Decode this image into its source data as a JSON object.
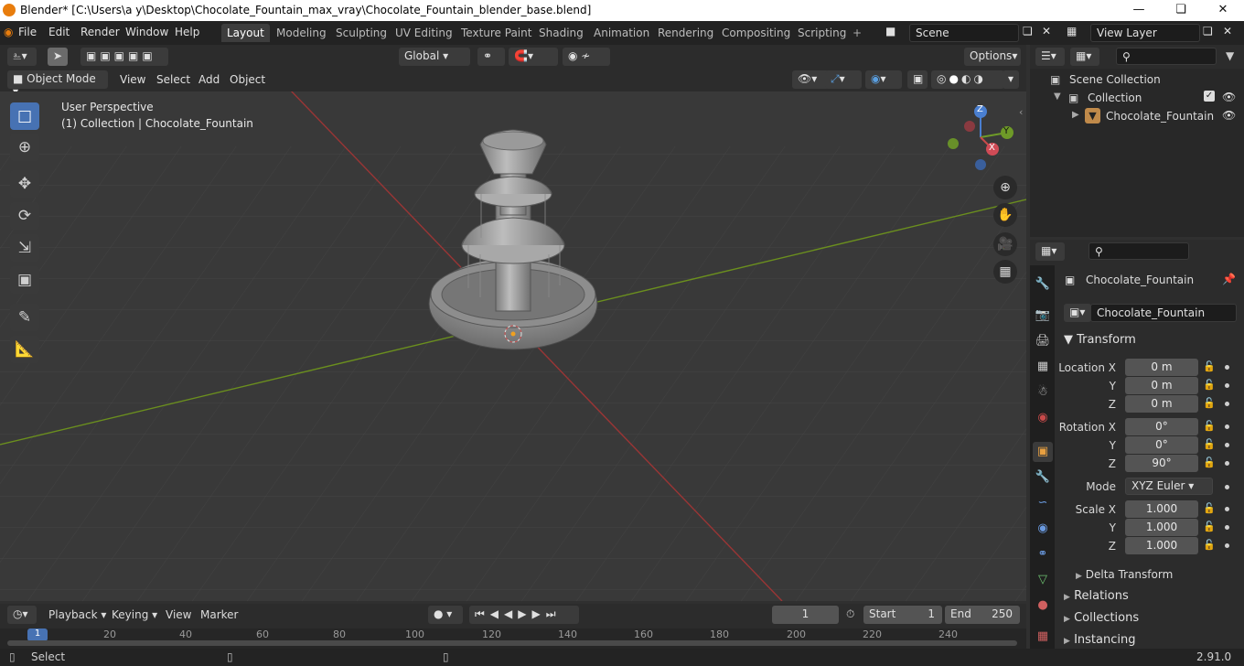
{
  "title": "Blender* [C:\\Users\\a y\\Desktop\\Chocolate_Fountain_max_vray\\Chocolate_Fountain_blender_base.blend]",
  "menu": [
    "File",
    "Edit",
    "Render",
    "Window",
    "Help"
  ],
  "workspaces": [
    "Layout",
    "Modeling",
    "Sculpting",
    "UV Editing",
    "Texture Paint",
    "Shading",
    "Animation",
    "Rendering",
    "Compositing",
    "Scripting"
  ],
  "active_workspace": "Layout",
  "scene": "Scene",
  "view_layer": "View Layer",
  "toolbar": {
    "orientation": "Global",
    "options": "Options"
  },
  "viewport_header": {
    "mode": "Object Mode",
    "items": [
      "View",
      "Select",
      "Add",
      "Object"
    ]
  },
  "viewport": {
    "perspective": "User Perspective",
    "context": "(1) Collection | Chocolate_Fountain"
  },
  "gizmo": {
    "x": "X",
    "y": "Y",
    "z": "Z"
  },
  "outliner": {
    "scene_collection": "Scene Collection",
    "collection": "Collection",
    "object": "Chocolate_Fountain"
  },
  "properties": {
    "object_name": "Chocolate_Fountain",
    "data_name": "Chocolate_Fountain",
    "transform": "Transform",
    "location": {
      "label_x": "Location X",
      "label_y": "Y",
      "label_z": "Z",
      "x": "0 m",
      "y": "0 m",
      "z": "0 m"
    },
    "rotation": {
      "label_x": "Rotation X",
      "label_y": "Y",
      "label_z": "Z",
      "x": "0°",
      "y": "0°",
      "z": "90°"
    },
    "mode_label": "Mode",
    "mode_value": "XYZ Euler",
    "scale": {
      "label_x": "Scale X",
      "label_y": "Y",
      "label_z": "Z",
      "x": "1.000",
      "y": "1.000",
      "z": "1.000"
    },
    "delta": "Delta Transform",
    "relations": "Relations",
    "collections": "Collections",
    "instancing": "Instancing"
  },
  "timeline": {
    "menus": [
      "Playback",
      "Keying",
      "View",
      "Marker"
    ],
    "current_frame": "1",
    "start_label": "Start",
    "start": "1",
    "end_label": "End",
    "end": "250",
    "ticks": [
      "1",
      "20",
      "40",
      "60",
      "80",
      "100",
      "120",
      "140",
      "160",
      "180",
      "200",
      "220",
      "240"
    ]
  },
  "status": {
    "left": "Select",
    "version": "2.91.0"
  }
}
